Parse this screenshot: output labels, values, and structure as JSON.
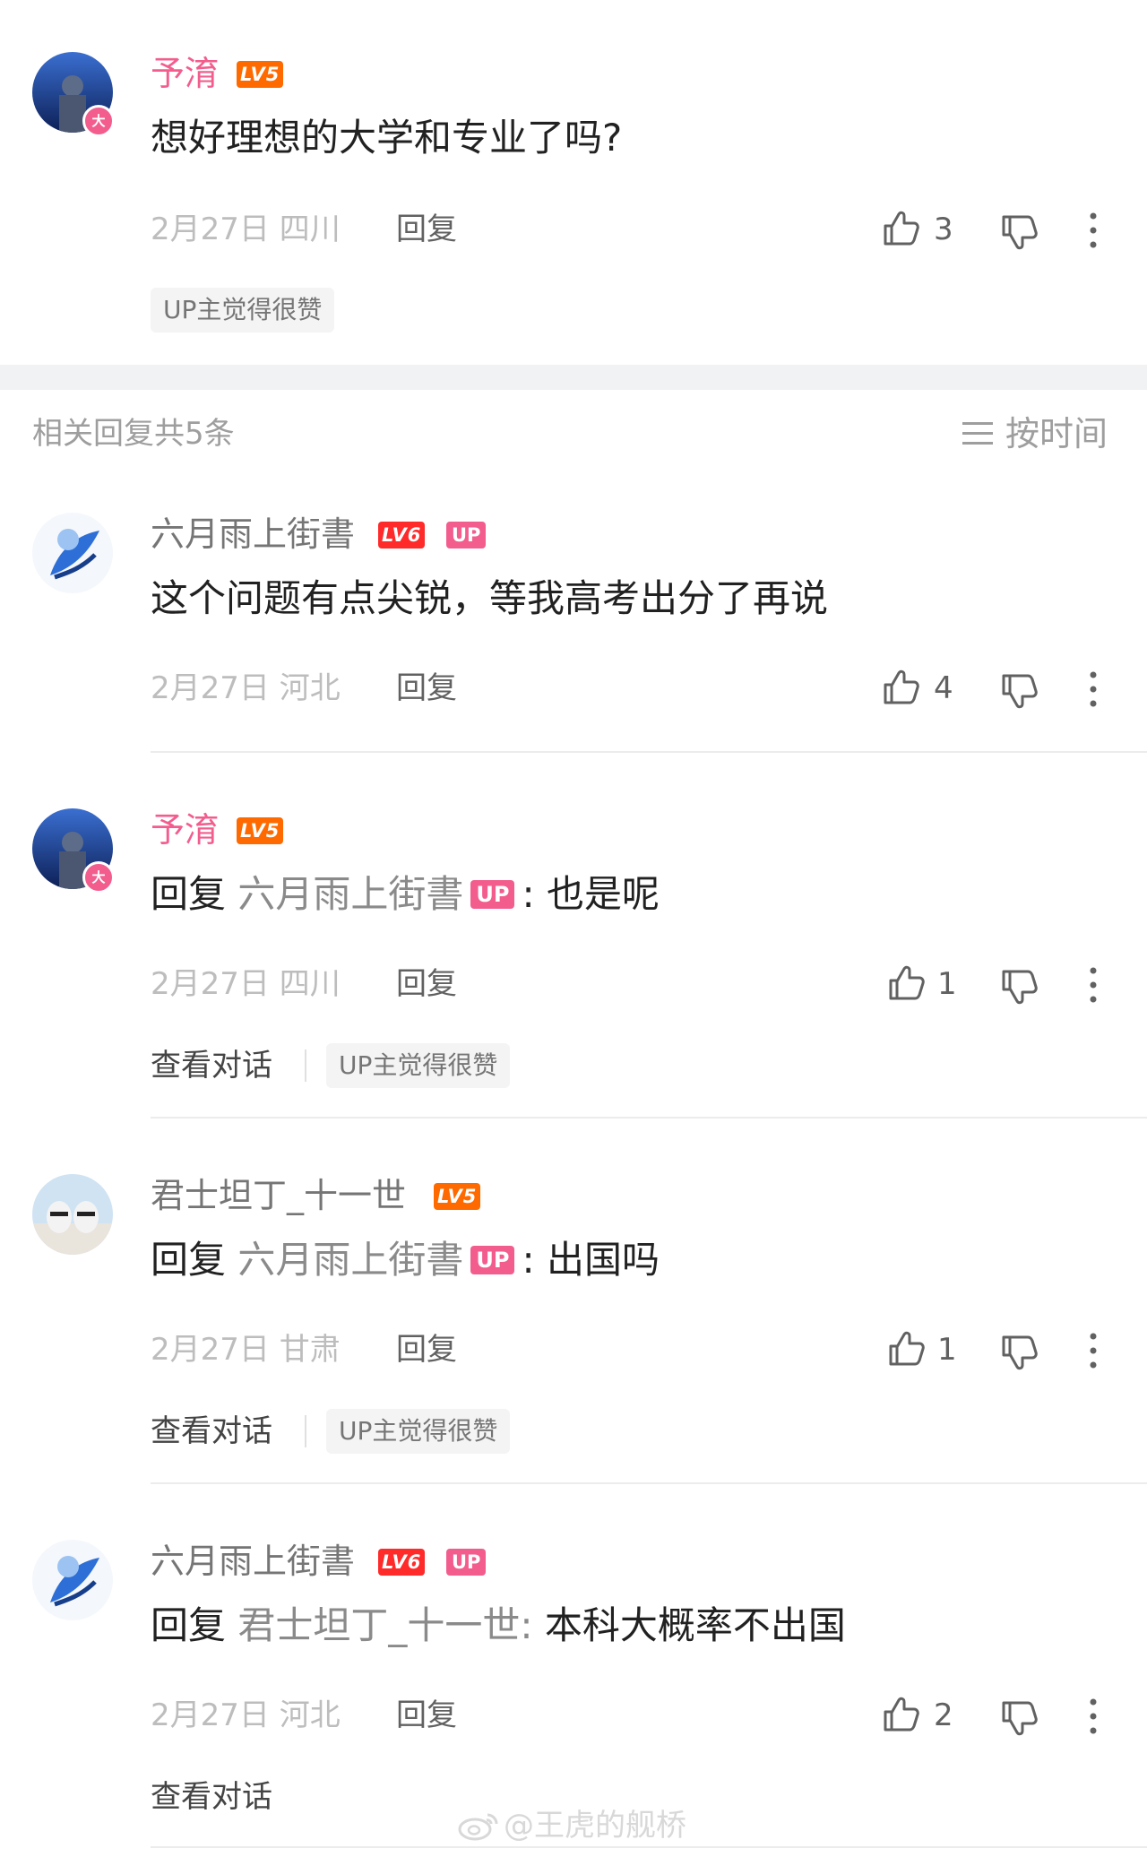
{
  "main_comment": {
    "username": "予淯",
    "level": "LV5",
    "vip_badge": "大",
    "text": "想好理想的大学和专业了吗?",
    "date_location": "2月27日 四川",
    "reply_label": "回复",
    "likes": "3",
    "up_liked_tag": "UP主觉得很赞"
  },
  "replies_header": {
    "title": "相关回复共5条",
    "sort_label": "按时间",
    "sort_icon": "menu-lines-icon"
  },
  "replies": [
    {
      "username": "六月雨上街書",
      "level": "LV6",
      "up_tag": "UP",
      "text": "这个问题有点尖锐，等我高考出分了再说",
      "date_location": "2月27日 河北",
      "reply_label": "回复",
      "likes": "4"
    },
    {
      "username": "予淯",
      "level": "LV5",
      "vip_badge": "大",
      "reply_prefix": "回复",
      "reply_to": "六月雨上街書",
      "reply_to_tag": "UP",
      "text": ": 也是呢",
      "date_location": "2月27日 四川",
      "reply_label": "回复",
      "likes": "1",
      "view_conversation": "查看对话",
      "up_liked_tag": "UP主觉得很赞"
    },
    {
      "username": "君士坦丁_十一世",
      "level": "LV5",
      "reply_prefix": "回复",
      "reply_to": "六月雨上街書",
      "reply_to_tag": "UP",
      "text": ": 出国吗",
      "date_location": "2月27日 甘肃",
      "reply_label": "回复",
      "likes": "1",
      "view_conversation": "查看对话",
      "up_liked_tag": "UP主觉得很赞"
    },
    {
      "username": "六月雨上街書",
      "level": "LV6",
      "up_tag": "UP",
      "reply_prefix": "回复",
      "reply_to": "君士坦丁_十一世:",
      "text": " 本科大概率不出国",
      "date_location": "2月27日 河北",
      "reply_label": "回复",
      "likes": "2",
      "view_conversation": "查看对话"
    }
  ],
  "watermark": {
    "text": "@王虎的舰桥",
    "icon": "weibo-icon"
  },
  "colors": {
    "accent_pink": "#f25d8e",
    "level5": "#ff6a00",
    "level6": "#ff2a2a"
  }
}
